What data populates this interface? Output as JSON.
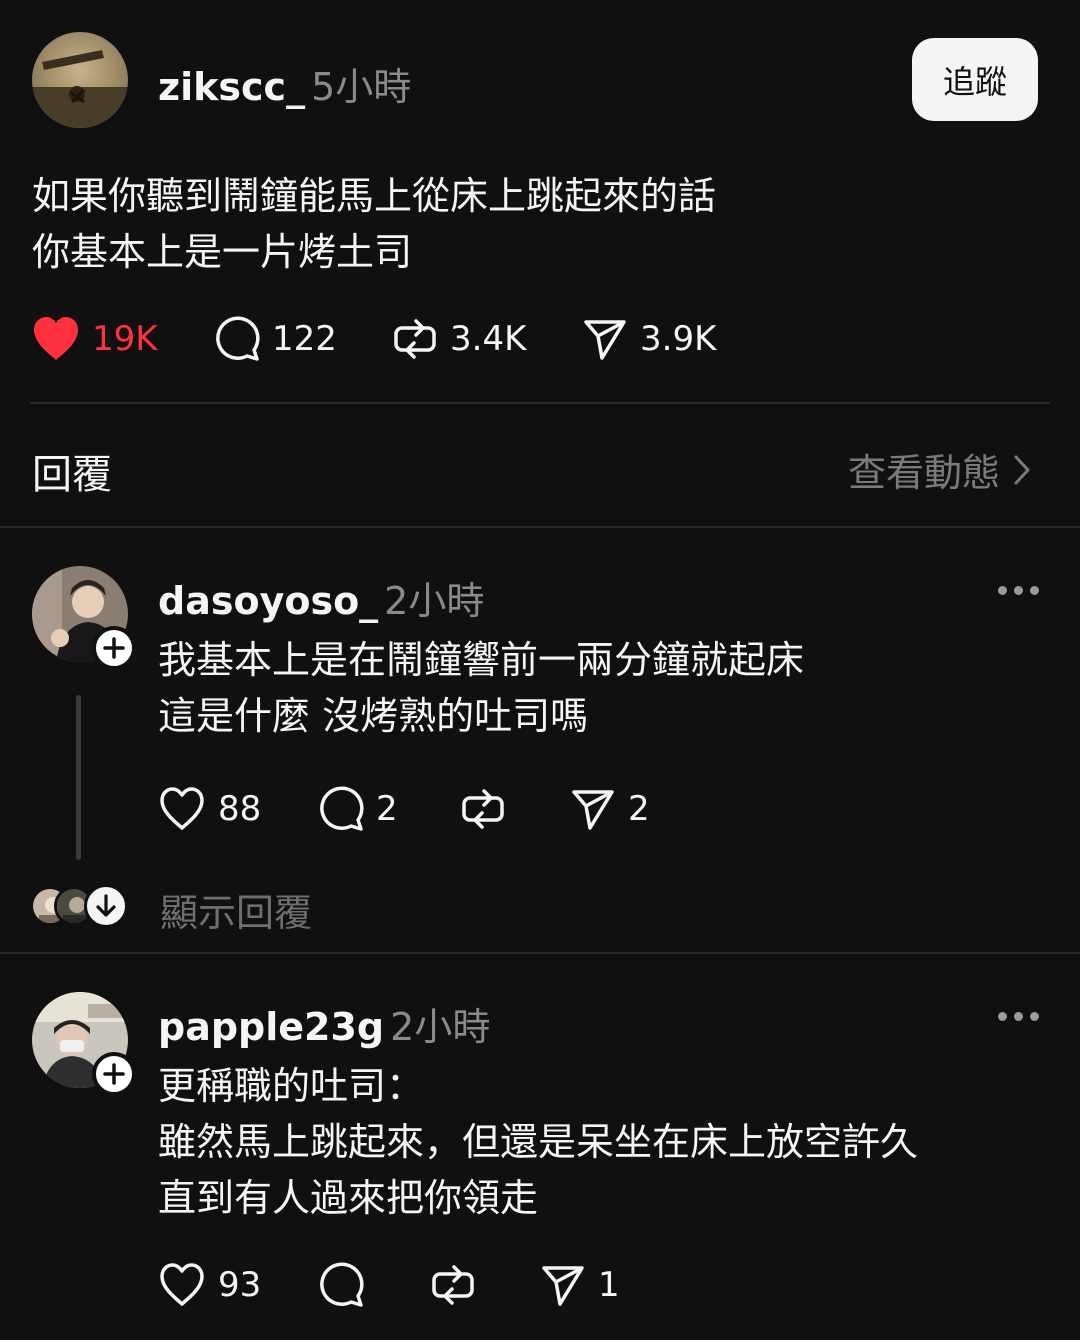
{
  "post": {
    "username": "zikscc_",
    "time": "5小時",
    "follow_label": "追蹤",
    "text_lines": [
      "如果你聽到鬧鐘能馬上從床上跳起來的話",
      "你基本上是一片烤土司"
    ],
    "likes": "19K",
    "comments": "122",
    "reposts": "3.4K",
    "shares": "3.9K",
    "liked": true,
    "like_color": "#ff3040"
  },
  "replies_header": {
    "label": "回覆",
    "view_activity": "查看動態"
  },
  "replies": [
    {
      "username": "dasoyoso_",
      "time": "2小時",
      "text_lines": [
        "我基本上是在鬧鐘響前一兩分鐘就起床",
        "這是什麼 沒烤熟的吐司嗎"
      ],
      "likes": "88",
      "comments": "2",
      "reposts": "",
      "shares": "2",
      "show_replies": "顯示回覆"
    },
    {
      "username": "papple23g",
      "time": "2小時",
      "text_lines": [
        "更稱職的吐司：",
        "雖然馬上跳起來，但還是呆坐在床上放空許久",
        "直到有人過來把你領走"
      ],
      "likes": "93",
      "comments": "",
      "reposts": "",
      "shares": "1"
    }
  ]
}
